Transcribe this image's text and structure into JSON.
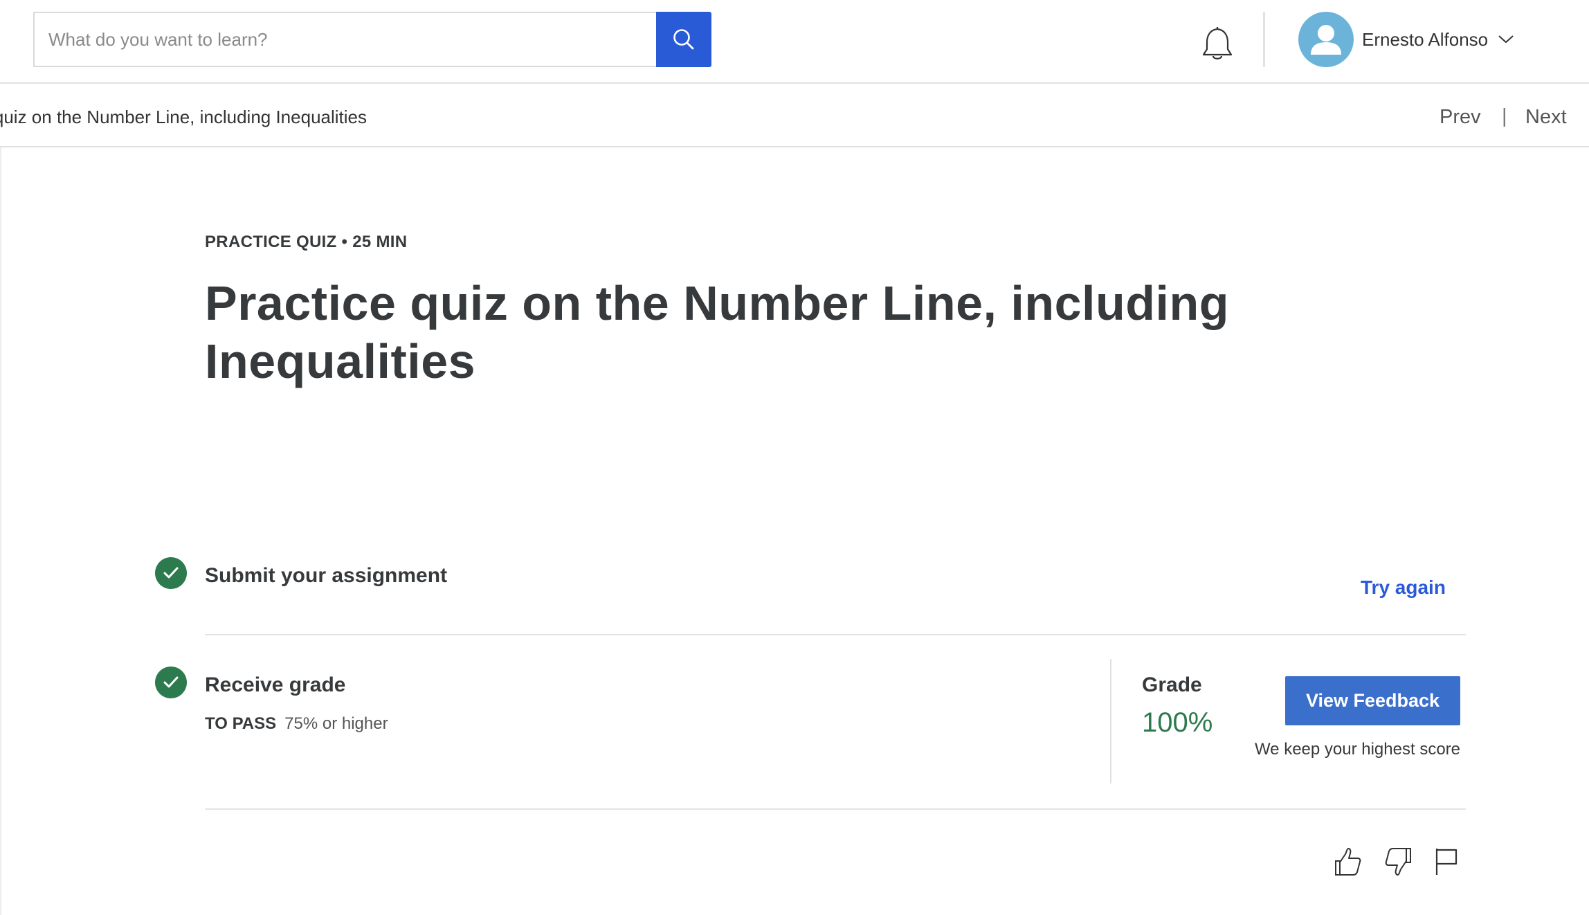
{
  "header": {
    "search": {
      "placeholder": "What do you want to learn?",
      "value": ""
    },
    "user": {
      "name": "Ernesto Alfonso"
    }
  },
  "subbar": {
    "breadcrumb": "Practice quiz on the Number Line, including Inequalities",
    "prev_label": "Prev",
    "separator": "|",
    "next_label": "Next"
  },
  "quiz": {
    "meta": "PRACTICE QUIZ • 25 MIN",
    "title": "Practice quiz on the Number Line, including Inequalities"
  },
  "steps": {
    "submit": {
      "title": "Submit your assignment",
      "action_label": "Try again"
    },
    "grade": {
      "title": "Receive grade",
      "pass_label": "TO PASS",
      "pass_value": "75% or higher",
      "grade_label": "Grade",
      "grade_value": "100%",
      "feedback_button": "View Feedback",
      "keep_note": "We keep your highest score"
    }
  },
  "icons": {
    "search": "search-icon",
    "bell": "bell-icon",
    "avatar": "user-avatar-icon",
    "chevron": "chevron-down-icon",
    "check": "check-circle-icon",
    "like": "thumbs-up-icon",
    "dislike": "thumbs-down-icon",
    "flag": "flag-icon"
  },
  "colors": {
    "primary": "#2a5bd7",
    "button": "#3a6fcc",
    "success": "#2e7a4f",
    "avatar_bg": "#6cb3da"
  }
}
